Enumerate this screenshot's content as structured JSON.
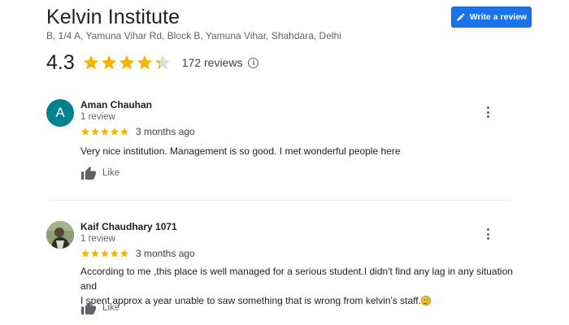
{
  "place": {
    "name": "Kelvin Institute",
    "address": "B, 1/4 A, Yamuna Vihar Rd, Block B, Yamuna Vihar, Shahdara, Delhi",
    "rating": "4.3",
    "rating_value": 4.3,
    "reviews_label": "172 reviews"
  },
  "actions": {
    "write_review_label": "Write a review",
    "write_review_icon": "pencil-icon",
    "info_icon": "info-icon"
  },
  "colors": {
    "star": "#f4b400",
    "star_empty": "#dadce0",
    "button": "#1a73e8",
    "avatar_teal": "#00838f"
  },
  "reviews": [
    {
      "avatar_letter": "A",
      "name": "Aman Chauhan",
      "meta": "1 review",
      "stars": 5,
      "date": "3 months ago",
      "text": "Very nice institution. Management is so good. I met wonderful people here",
      "like_label": "Like"
    },
    {
      "avatar_letter": "",
      "name": "Kaif Chaudhary 1071",
      "meta": "1 review",
      "stars": 5,
      "date": "3 months ago",
      "text_line1": "According to me ,this place is well managed for a serious student.I didn't find any lag in any situation and",
      "text_line2": "I spent approx a year unable to saw something that is wrong from kelvin's staff.",
      "like_label": "Like"
    }
  ]
}
